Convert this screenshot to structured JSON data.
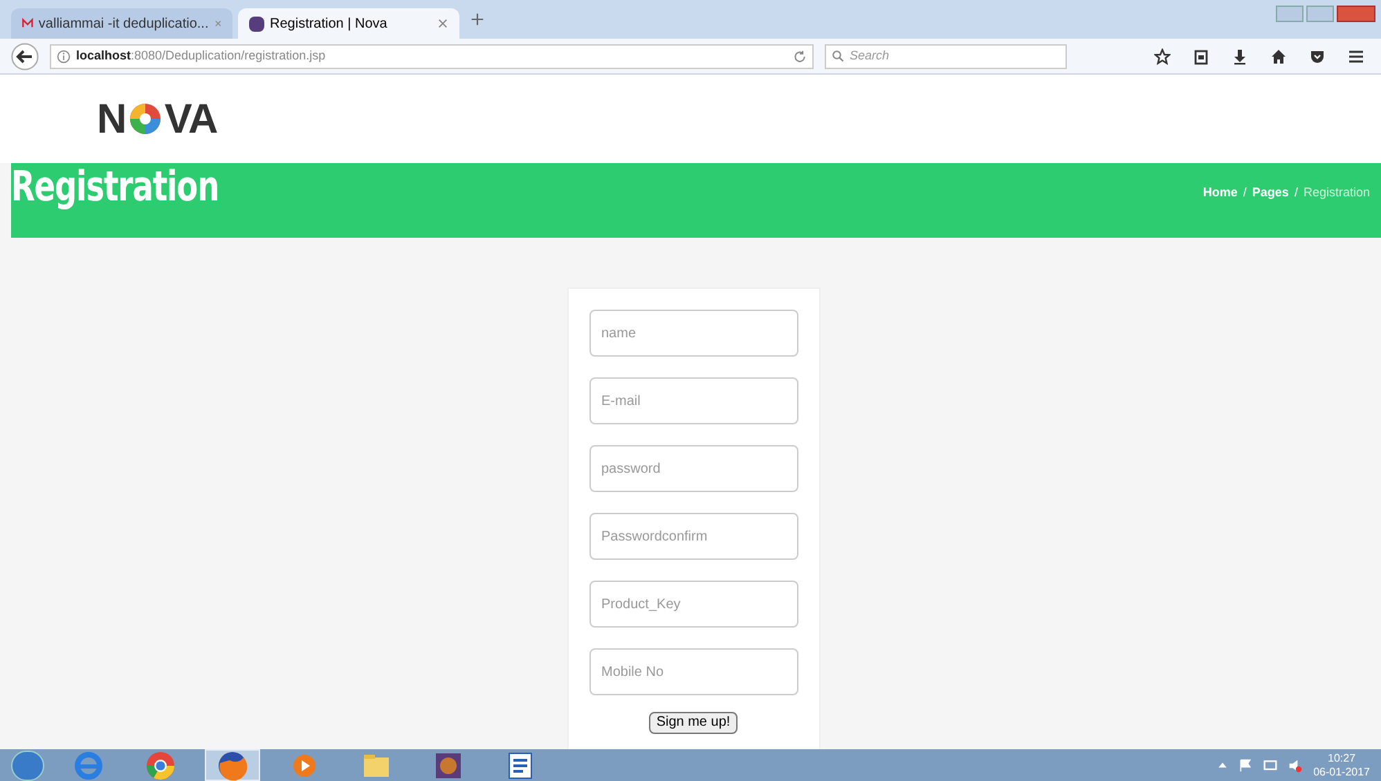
{
  "browser": {
    "tabs": [
      {
        "title": "valliammai -it deduplicatio...",
        "selected": false
      },
      {
        "title": "Registration | Nova",
        "selected": true
      }
    ],
    "url_host": "localhost",
    "url_rest": ":8080/Deduplication/registration.jsp",
    "search_placeholder": "Search"
  },
  "logo": {
    "left": "N",
    "right": "VA"
  },
  "banner": {
    "title": "Registration",
    "breadcrumb": [
      {
        "label": "Home",
        "selected": false
      },
      {
        "label": "Pages",
        "selected": false
      },
      {
        "label": "Registration",
        "selected": true
      }
    ],
    "separator": "/"
  },
  "form": {
    "fields": [
      {
        "placeholder": "name"
      },
      {
        "placeholder": "E-mail"
      },
      {
        "placeholder": "password"
      },
      {
        "placeholder": "Passwordconfirm"
      },
      {
        "placeholder": "Product_Key"
      },
      {
        "placeholder": "Mobile No"
      }
    ],
    "submit": "Sign me up!"
  },
  "taskbar": {
    "apps": [
      {
        "kind": "ie",
        "selected": false
      },
      {
        "kind": "chrome",
        "selected": false
      },
      {
        "kind": "firefox",
        "selected": true
      },
      {
        "kind": "media",
        "selected": false
      },
      {
        "kind": "folder",
        "selected": false
      },
      {
        "kind": "game",
        "selected": false
      },
      {
        "kind": "word",
        "selected": false
      }
    ],
    "time": "10:27",
    "date": "06-01-2017"
  }
}
